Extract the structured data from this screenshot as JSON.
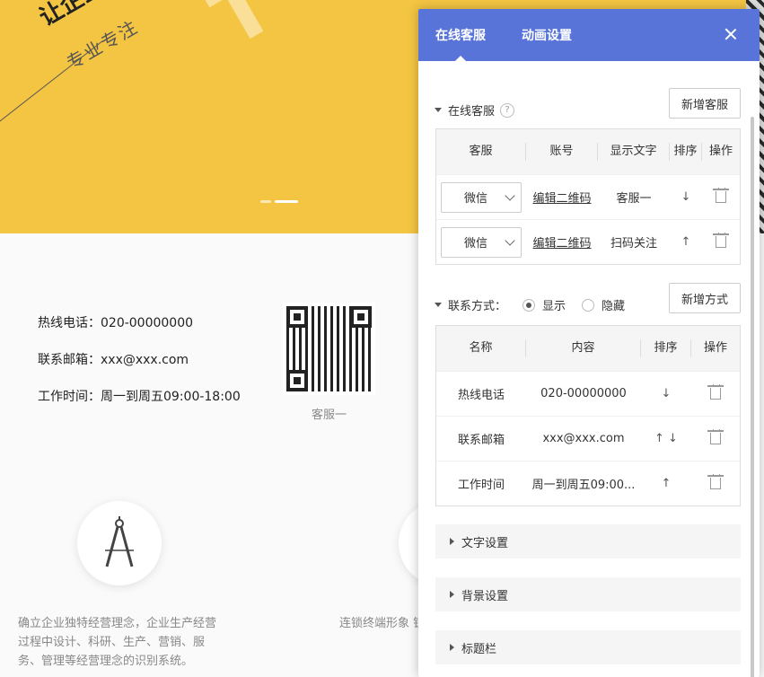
{
  "website": {
    "hero_title": "让企业",
    "hero_subtitle": "专业专注",
    "contact": {
      "hotline": "热线电话：020-00000000",
      "email": "联系邮箱：xxx@xxx.com",
      "hours": "工作时间：周一到周五09:00-18:00"
    },
    "qr_label": "客服一",
    "feature1_text": "确立企业独特经营理念，企业生产经营过程中设计、科研、生产、营销、服务、管理等经营理念的识别系统。",
    "feature2_text": "连锁终端形象 锁加盟性质的 设计与"
  },
  "panel": {
    "tabs": [
      {
        "label": "在线客服",
        "active": true
      },
      {
        "label": "动画设置",
        "active": false
      }
    ],
    "service": {
      "title": "在线客服",
      "help": "?",
      "add_button": "新增客服",
      "headers": [
        "客服",
        "账号",
        "显示文字",
        "排序",
        "操作"
      ],
      "rows": [
        {
          "type": "微信",
          "account": "编辑二维码",
          "text": "客服一",
          "sort": "↓"
        },
        {
          "type": "微信",
          "account": "编辑二维码",
          "text": "扫码关注",
          "sort": "↑"
        }
      ]
    },
    "contact": {
      "title": "联系方式：",
      "options": [
        "显示",
        "隐藏"
      ],
      "selected": "显示",
      "add_button": "新增方式",
      "headers": [
        "名称",
        "内容",
        "排序",
        "操作"
      ],
      "rows": [
        {
          "name": "热线电话",
          "content": "020-00000000",
          "sort": "↓"
        },
        {
          "name": "联系邮箱",
          "content": "xxx@xxx.com",
          "sort": "↑ ↓"
        },
        {
          "name": "工作时间",
          "content": "周一到周五09:00...",
          "sort": "↑"
        }
      ]
    },
    "sections": [
      "文字设置",
      "背景设置",
      "标题栏"
    ]
  },
  "colors": {
    "header": "#5874d8",
    "hero": "#f4c542"
  }
}
